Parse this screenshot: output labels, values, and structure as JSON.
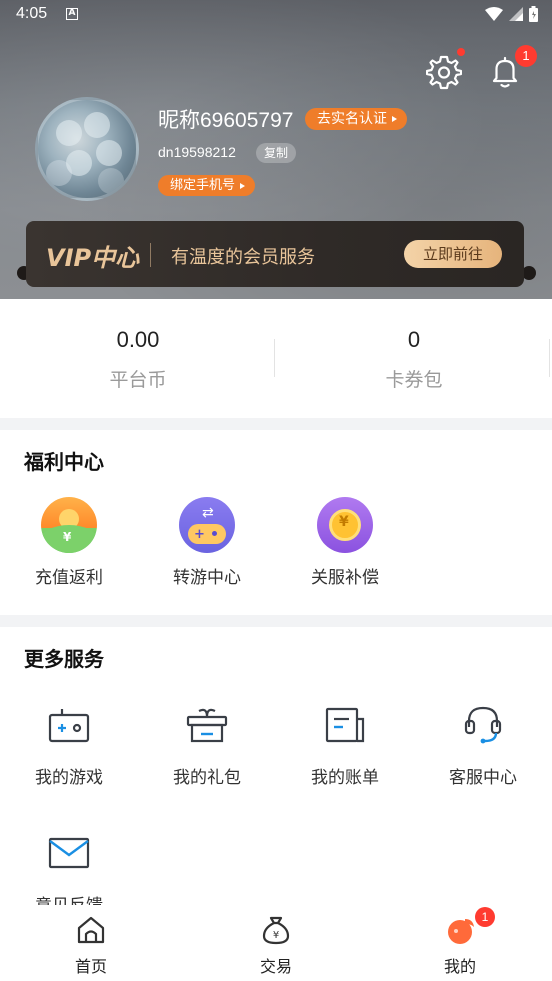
{
  "status_bar": {
    "time": "4:05",
    "notification_glyph": "A"
  },
  "header": {
    "nickname": "昵称69605797",
    "realname_label": "去实名认证",
    "account_id": "dn19598212",
    "copy_label": "复制",
    "bind_phone_label": "绑定手机号",
    "bell_badge": "1"
  },
  "vip": {
    "title": "VIP中心",
    "subtitle": "有温度的会员服务",
    "button_label": "立即前往"
  },
  "stats": [
    {
      "value": "0.00",
      "label": "平台币"
    },
    {
      "value": "0",
      "label": "卡券包"
    }
  ],
  "welfare": {
    "title": "福利中心",
    "items": [
      {
        "label": "充值返利",
        "icon": "recharge-rebate-icon"
      },
      {
        "label": "转游中心",
        "icon": "game-transfer-icon"
      },
      {
        "label": "关服补偿",
        "icon": "server-compensation-icon"
      }
    ]
  },
  "more": {
    "title": "更多服务",
    "items": [
      {
        "label": "我的游戏",
        "icon": "game-console-icon"
      },
      {
        "label": "我的礼包",
        "icon": "gift-box-icon"
      },
      {
        "label": "我的账单",
        "icon": "bill-icon"
      },
      {
        "label": "客服中心",
        "icon": "headset-icon"
      },
      {
        "label": "意见反馈",
        "icon": "mail-icon"
      }
    ]
  },
  "bottom_nav": {
    "items": [
      {
        "label": "首页",
        "icon": "home-icon"
      },
      {
        "label": "交易",
        "icon": "money-bag-icon"
      },
      {
        "label": "我的",
        "icon": "profile-icon"
      }
    ],
    "profile_badge": "1"
  },
  "colors": {
    "accent_orange": "#ef7d2a",
    "badge_red": "#ff3b30",
    "vip_gold": "#e9c59a",
    "icon_blue": "#1a8fe3"
  }
}
